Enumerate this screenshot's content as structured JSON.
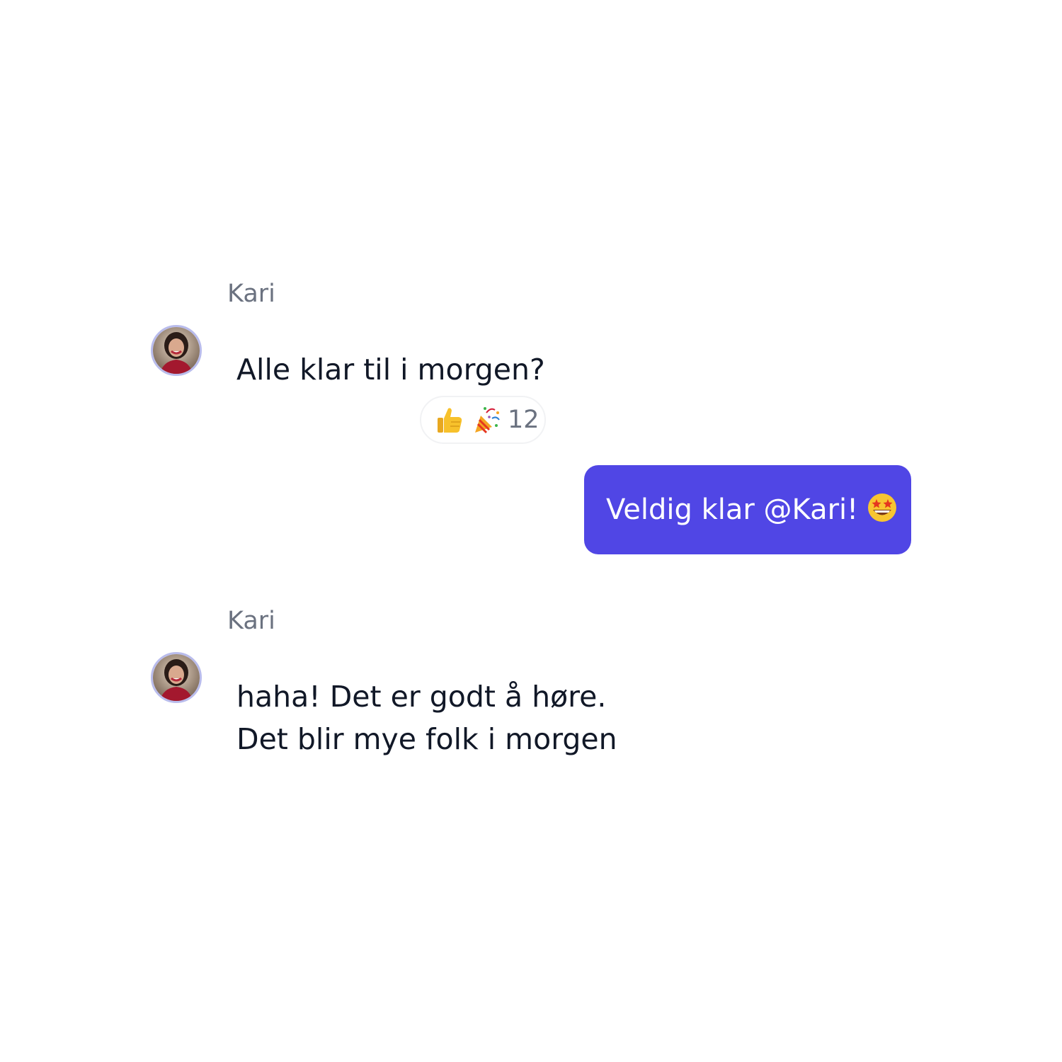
{
  "colors": {
    "accent": "#5046e5",
    "sender_name": "#6b7280",
    "message_text": "#111827",
    "avatar_ring": "#b9bcec"
  },
  "messages": [
    {
      "sender": "Kari",
      "avatar_icon": "avatar-photo",
      "text": "Alle klar til i morgen?",
      "reactions": {
        "icons": [
          "thumbs-up-icon",
          "party-popper-icon"
        ],
        "count": "12"
      }
    },
    {
      "outgoing": true,
      "text": "Veldig klar @Kari!",
      "trailing_icon": "star-struck-icon"
    },
    {
      "sender": "Kari",
      "avatar_icon": "avatar-photo",
      "text": "haha! Det er godt å høre.\nDet blir mye folk i morgen"
    }
  ]
}
